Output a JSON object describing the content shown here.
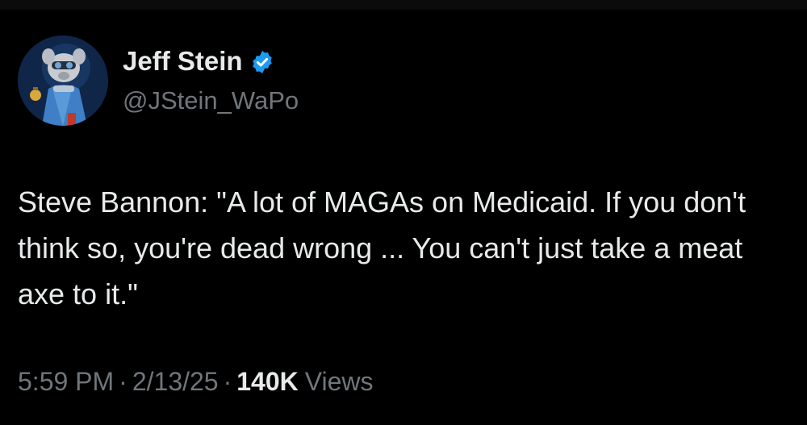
{
  "author": {
    "name": "Jeff Stein",
    "handle": "@JStein_WaPo",
    "verified": true,
    "verified_color": "#1d9bf0"
  },
  "tweet": {
    "text": "Steve Bannon: \"A lot of MAGAs on Medicaid. If you don't think so, you're dead wrong ... You can't just take a meat axe to it.\""
  },
  "meta": {
    "time": "5:59 PM",
    "separator": "·",
    "date": "2/13/25",
    "views_count": "140K",
    "views_label": "Views"
  },
  "colors": {
    "background": "#000000",
    "text_primary": "#e7e9ea",
    "text_secondary": "#71767b"
  }
}
